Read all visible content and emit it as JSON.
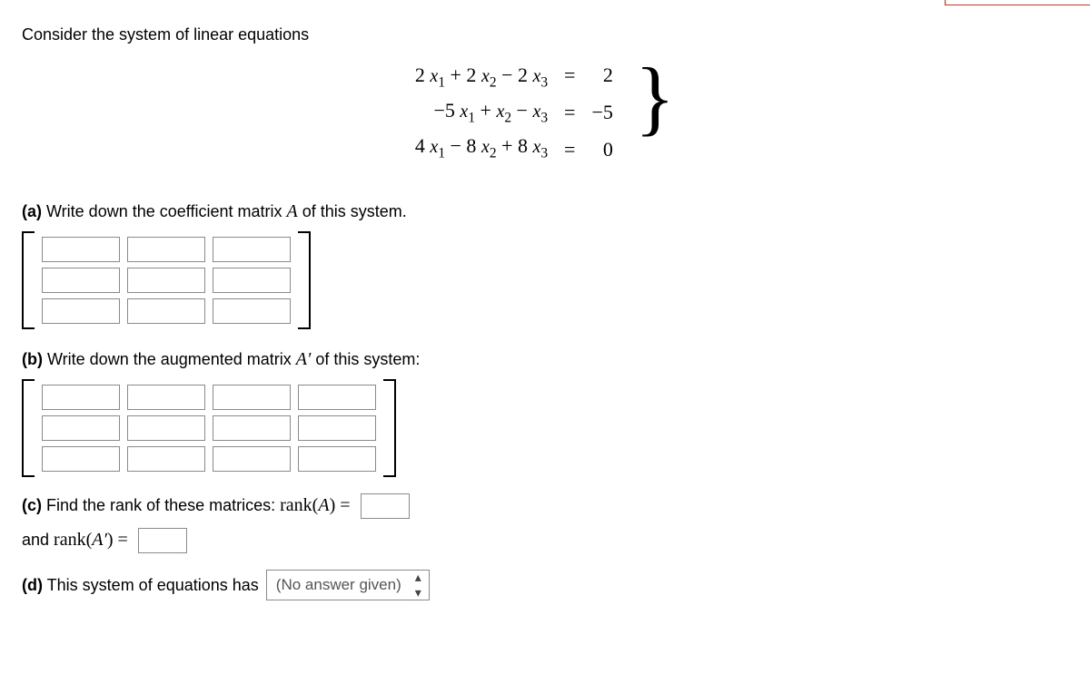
{
  "intro": "Consider the system of linear equations",
  "equations": {
    "lhs": [
      "2 x₁ + 2 x₂ − 2 x₃",
      "−5 x₁ + x₂ − x₃",
      "4 x₁ − 8 x₂ + 8 x₃"
    ],
    "eq": [
      "=",
      "=",
      "="
    ],
    "rhs": [
      "2",
      "−5",
      "0"
    ]
  },
  "parts": {
    "a": {
      "label": "(a)",
      "text": "Write down the coefficient matrix ",
      "mathA": "A",
      "tail": " of this system."
    },
    "b": {
      "label": "(b)",
      "text": "Write down the augmented matrix ",
      "mathAprime": "A′",
      "tail": " of this system:"
    },
    "c": {
      "label": "(c)",
      "text": "Find the rank of these matrices: ",
      "rank_label": "rank(",
      "A": "A",
      "close": ") ="
    },
    "c2": {
      "and": "and ",
      "rank_label": "rank(",
      "Aprime": "A′",
      "close": ") ="
    },
    "d": {
      "label": "(d)",
      "text": "This system of equations has"
    }
  },
  "select": {
    "placeholder": "(No answer given)"
  }
}
